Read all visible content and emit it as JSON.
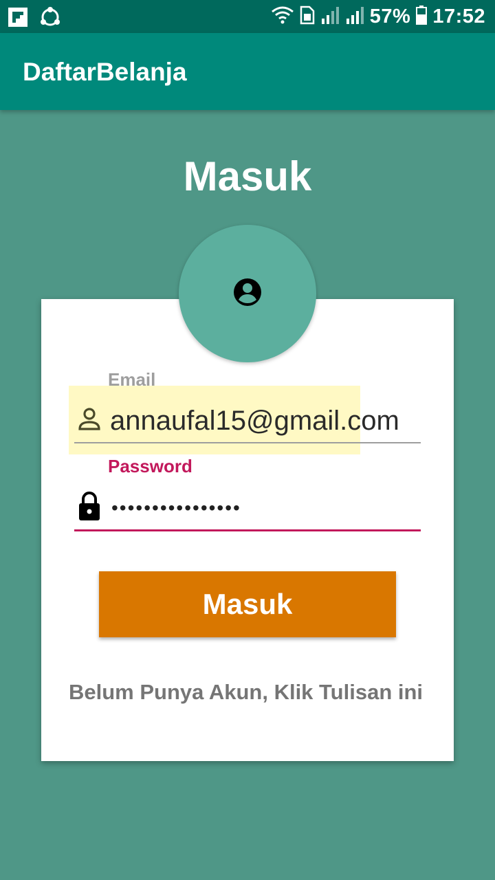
{
  "status_bar": {
    "battery": "57%",
    "time": "17:52",
    "left_icons": [
      "flipboard-icon",
      "share-icon"
    ],
    "right_icons": [
      "wifi-icon",
      "sim-icon",
      "signal-icon",
      "signal-icon",
      "battery-icon"
    ]
  },
  "app_bar": {
    "title": "DaftarBelanja"
  },
  "page": {
    "title": "Masuk"
  },
  "form": {
    "email_label": "Email",
    "email_value": "annaufal15@gmail.com",
    "password_label": "Password",
    "password_value": "••••••••••••••••",
    "submit_label": "Masuk",
    "register_text": "Belum Punya Akun, Klik Tulisan ini"
  },
  "colors": {
    "status_bar": "#00695c",
    "app_bar": "#00897b",
    "background": "#4f9787",
    "accent": "#c2185b",
    "button": "#d97700"
  }
}
